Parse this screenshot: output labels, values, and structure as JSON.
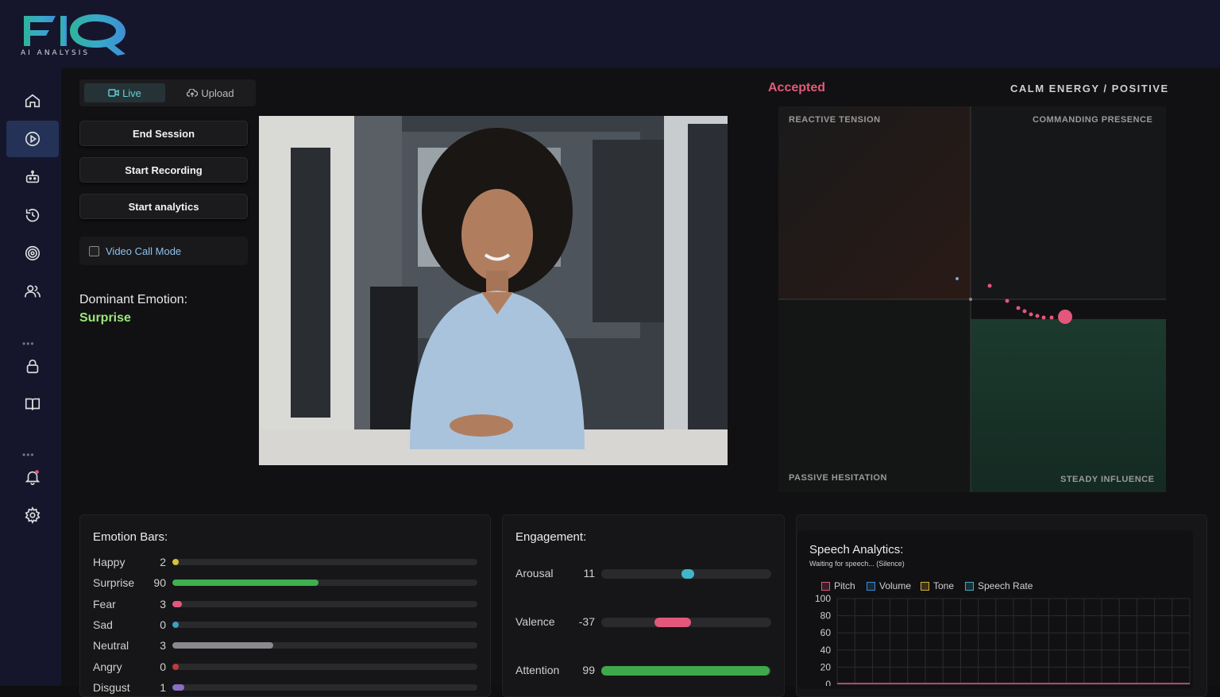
{
  "app": {
    "logo_text": "FIQ",
    "logo_subtitle": "AI ANALYSIS"
  },
  "sidebar": {
    "items": [
      {
        "icon": "home-icon"
      },
      {
        "icon": "play-circle-icon",
        "active": true
      },
      {
        "icon": "robot-icon"
      },
      {
        "icon": "history-icon"
      },
      {
        "icon": "target-icon"
      },
      {
        "icon": "users-icon"
      },
      {
        "icon": "lock-icon"
      },
      {
        "icon": "book-icon"
      },
      {
        "icon": "bell-icon"
      },
      {
        "icon": "gear-icon"
      }
    ],
    "divider": "•••"
  },
  "mode": {
    "live_label": "Live",
    "upload_label": "Upload"
  },
  "controls": {
    "end_session": "End Session",
    "start_recording": "Start Recording",
    "start_analytics": "Start analytics",
    "video_call_mode": "Video Call Mode"
  },
  "dominant": {
    "label": "Dominant Emotion:",
    "value": "Surprise"
  },
  "status": {
    "accepted": "Accepted",
    "energy": "CALM ENERGY / POSITIVE"
  },
  "quadrant": {
    "top_left": "REACTIVE TENSION",
    "top_right": "COMMANDING PRESENCE",
    "bottom_left": "PASSIVE HESITATION",
    "bottom_right": "STEADY INFLUENCE"
  },
  "emotions": {
    "title": "Emotion Bars:",
    "items": [
      {
        "name": "Happy",
        "value": 2,
        "fill": 0.02,
        "color": "#d6c23a"
      },
      {
        "name": "Surprise",
        "value": 90,
        "fill": 0.48,
        "color": "#3fb04f"
      },
      {
        "name": "Fear",
        "value": 3,
        "fill": 0.03,
        "color": "#e2577b"
      },
      {
        "name": "Sad",
        "value": 0,
        "fill": 0.01,
        "color": "#3aa0c4"
      },
      {
        "name": "Neutral",
        "value": 3,
        "fill": 0.33,
        "color": "#8a8a8e"
      },
      {
        "name": "Angry",
        "value": 0,
        "fill": 0.01,
        "color": "#c23a3a"
      },
      {
        "name": "Disgust",
        "value": 1,
        "fill": 0.04,
        "color": "#8a6ec4"
      }
    ]
  },
  "engagement": {
    "title": "Engagement:",
    "items": [
      {
        "name": "Arousal",
        "value": 11,
        "kind": "knob",
        "pos": 0.51,
        "color": "#3fb7c9"
      },
      {
        "name": "Valence",
        "value": -37,
        "kind": "knob-wide",
        "pos": 0.42,
        "color": "#e2577b"
      },
      {
        "name": "Attention",
        "value": 99,
        "kind": "fill",
        "pos": 0.99,
        "color": "#3fa84b"
      }
    ]
  },
  "speech": {
    "title": "Speech Analytics:",
    "subtitle": "Waiting for speech... (Silence)",
    "legend": [
      {
        "name": "Pitch",
        "color": "#e2577b"
      },
      {
        "name": "Volume",
        "color": "#3a8ad6"
      },
      {
        "name": "Tone",
        "color": "#d6b23a"
      },
      {
        "name": "Speech Rate",
        "color": "#3ab0c4"
      }
    ],
    "y_ticks": [
      "100",
      "80",
      "60",
      "40",
      "20",
      "0"
    ]
  }
}
